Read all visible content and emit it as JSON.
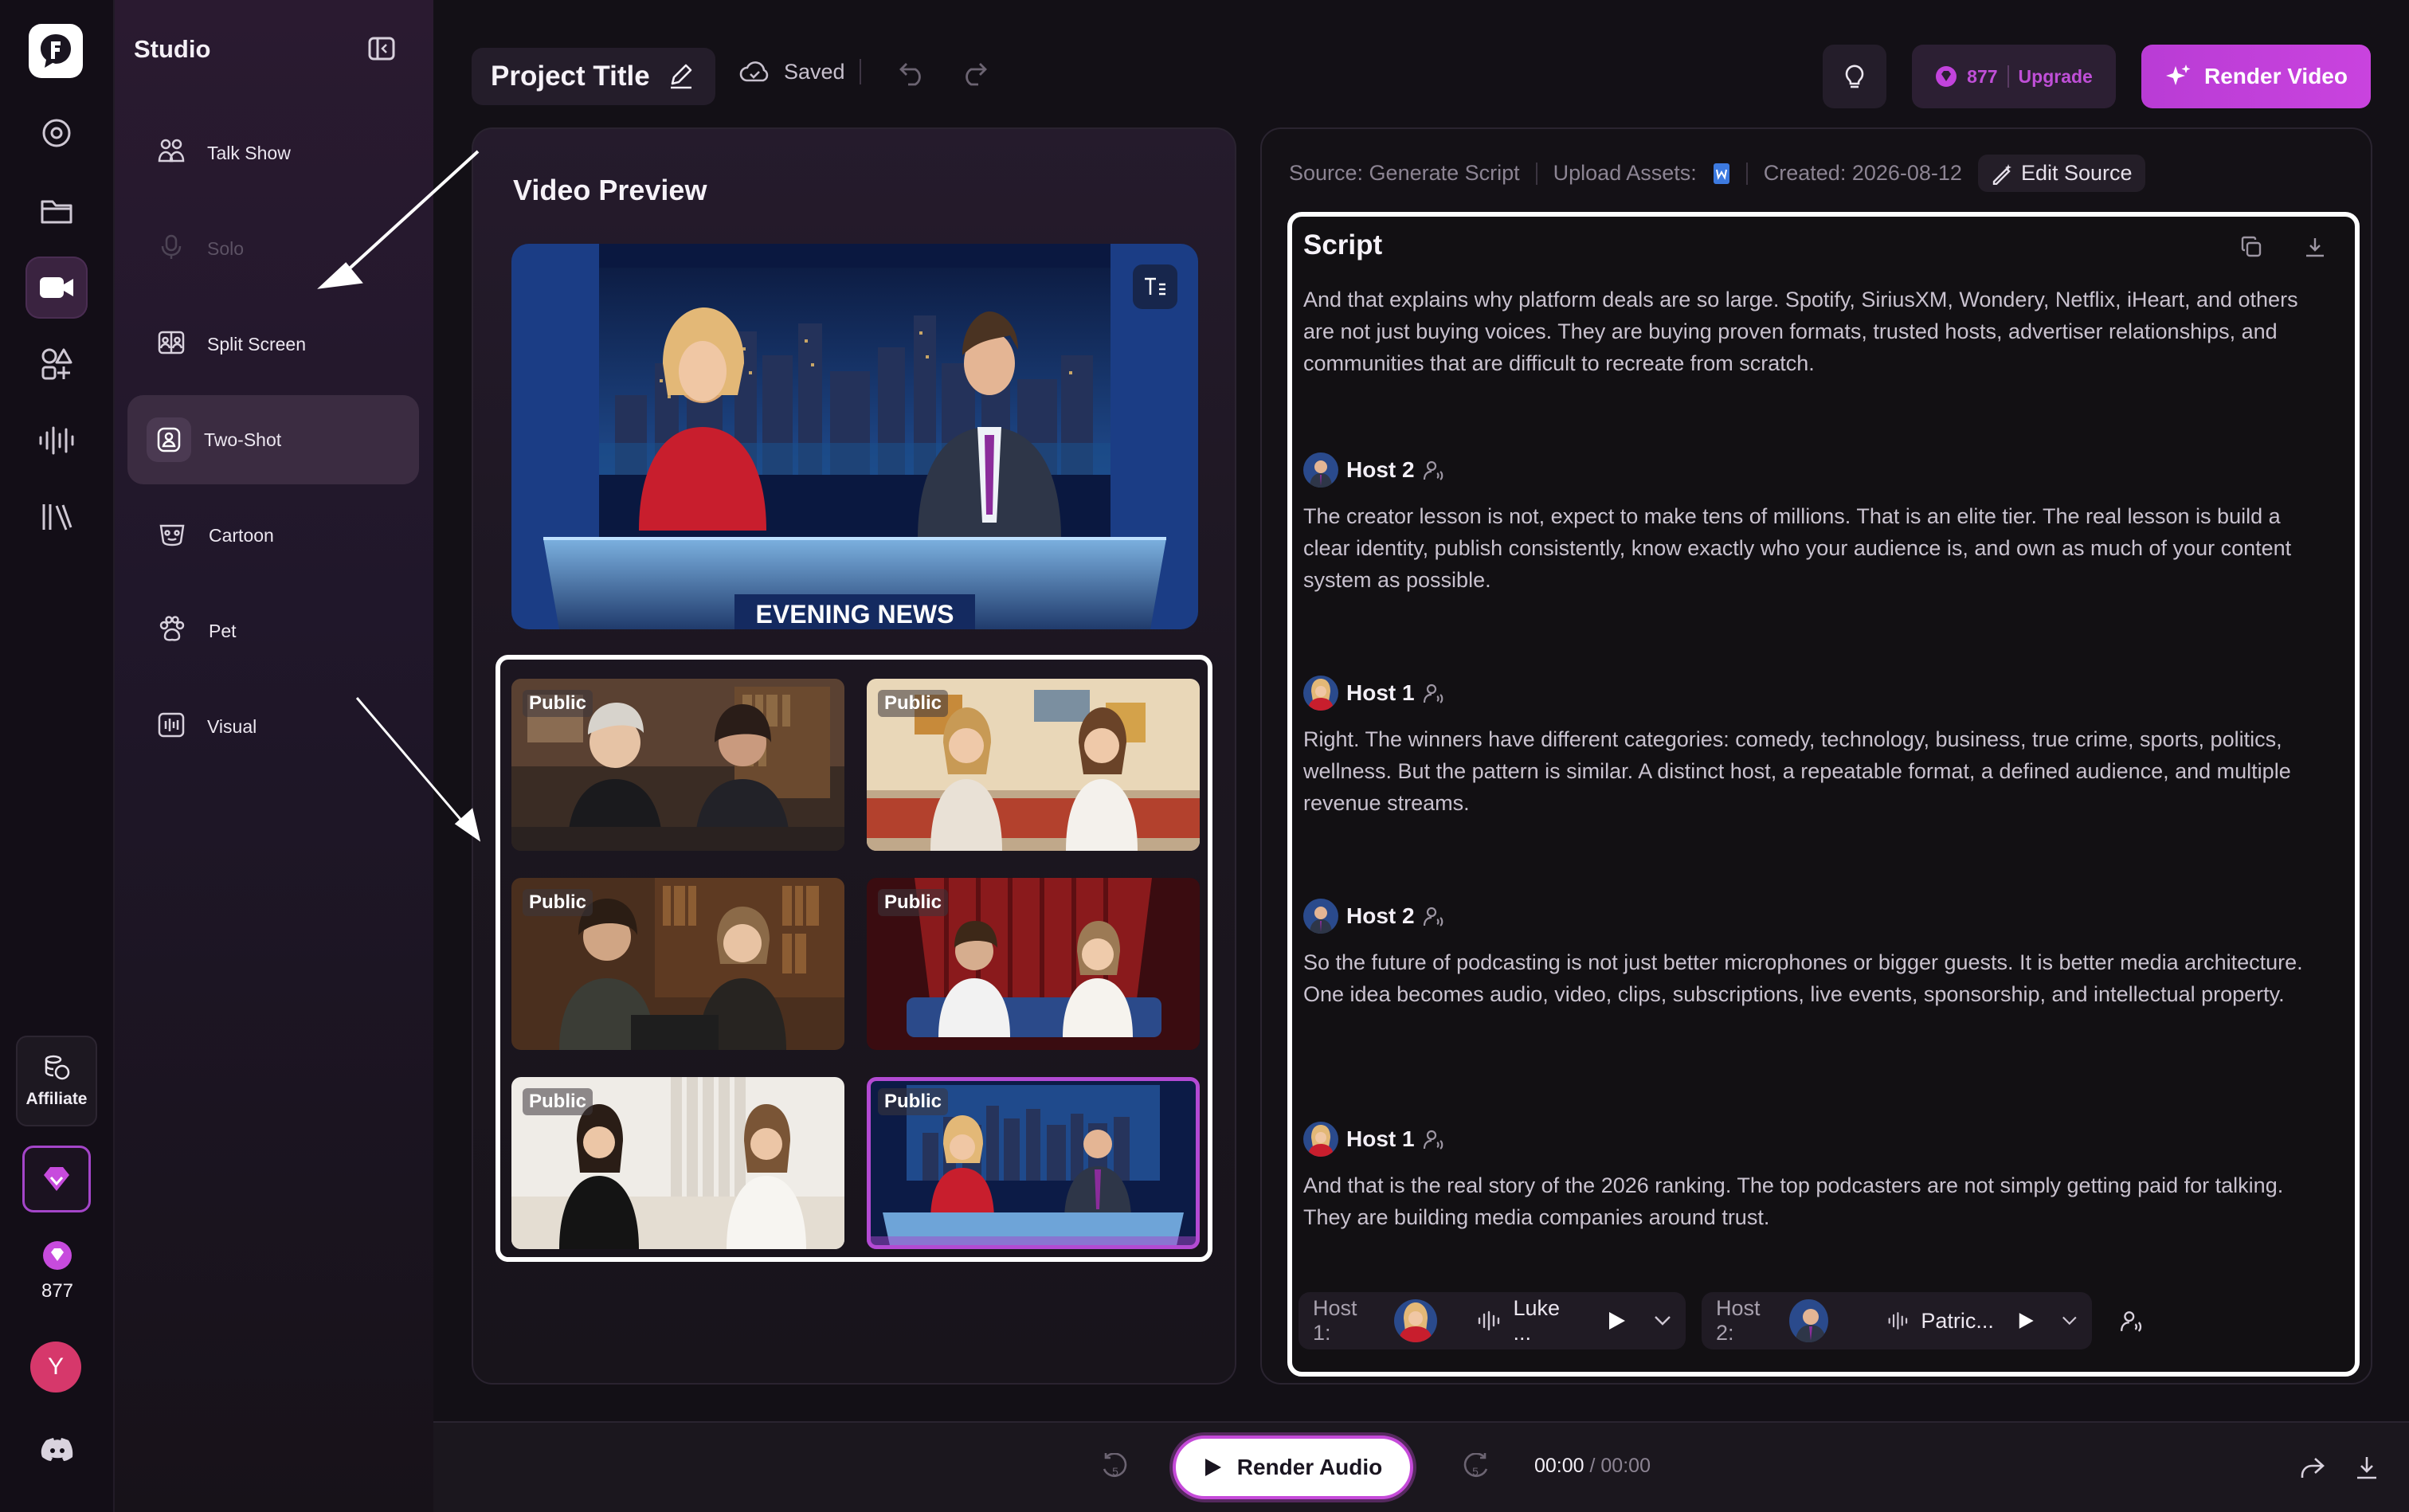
{
  "app": {
    "name": "Studio",
    "brand_color": "#c243dc"
  },
  "rail": {
    "items": [
      {
        "name": "dashboard-icon"
      },
      {
        "name": "folder-icon"
      },
      {
        "name": "video-camera-icon"
      },
      {
        "name": "shapes-icon"
      },
      {
        "name": "audio-waveform-icon"
      },
      {
        "name": "library-icon"
      }
    ],
    "affiliate_label": "Affiliate",
    "credits": "877",
    "user_initial": "Y"
  },
  "studio": {
    "title": "Studio",
    "items": [
      {
        "label": "Talk Show",
        "icon": "people-icon"
      },
      {
        "label": "Solo",
        "icon": "microphone-icon",
        "disabled": true
      },
      {
        "label": "Split Screen",
        "icon": "split-screen-icon"
      },
      {
        "label": "Two-Shot",
        "icon": "two-shot-icon",
        "active": true
      },
      {
        "label": "Cartoon",
        "icon": "cartoon-icon"
      },
      {
        "label": "Pet",
        "icon": "paw-icon"
      },
      {
        "label": "Visual",
        "icon": "visual-icon"
      }
    ]
  },
  "topbar": {
    "project_title": "Project Title",
    "saved": "Saved",
    "credits": "877",
    "upgrade": "Upgrade",
    "render_video": "Render Video"
  },
  "preview": {
    "title": "Video Preview",
    "banner_text": "EVENING NEWS",
    "templates": [
      {
        "badge": "Public"
      },
      {
        "badge": "Public"
      },
      {
        "badge": "Public"
      },
      {
        "badge": "Public"
      },
      {
        "badge": "Public"
      },
      {
        "badge": "Public",
        "selected": true
      }
    ]
  },
  "script": {
    "source": "Source: Generate Script",
    "upload": "Upload Assets:",
    "created": "Created: 2026-08-12",
    "edit_source": "Edit Source",
    "title": "Script",
    "intro": "And that explains why platform deals are so large. Spotify, SiriusXM, Wondery, Netflix, iHeart, and others are not just buying voices. They are buying proven formats, trusted hosts, advertiser relationships, and communities that are difficult to recreate from scratch.",
    "turns": [
      {
        "host": "Host 2",
        "text": "The creator lesson is not, expect to make tens of millions. That is an elite tier. The real lesson is build a clear identity, publish consistently, know exactly who your audience is, and own as much of your content system as possible."
      },
      {
        "host": "Host 1",
        "text": "Right. The winners have different categories: comedy, technology, business, true crime, sports, politics, wellness. But the pattern is similar. A distinct host, a repeatable format, a defined audience, and multiple revenue streams."
      },
      {
        "host": "Host 2",
        "text": "So the future of podcasting is not just better microphones or bigger guests. It is better media architecture. One idea becomes audio, video, clips, subscriptions, live events, sponsorship, and intellectual property."
      },
      {
        "host": "Host 1",
        "text": "And that is the real story of the 2026 ranking. The top podcasters are not simply getting paid for talking. They are building media companies around trust."
      }
    ],
    "voices": [
      {
        "label": "Host 1:",
        "voice": "Luke ..."
      },
      {
        "label": "Host 2:",
        "voice": "Patric..."
      }
    ]
  },
  "player": {
    "render_audio": "Render Audio",
    "current": "00:00",
    "total": "/ 00:00"
  }
}
